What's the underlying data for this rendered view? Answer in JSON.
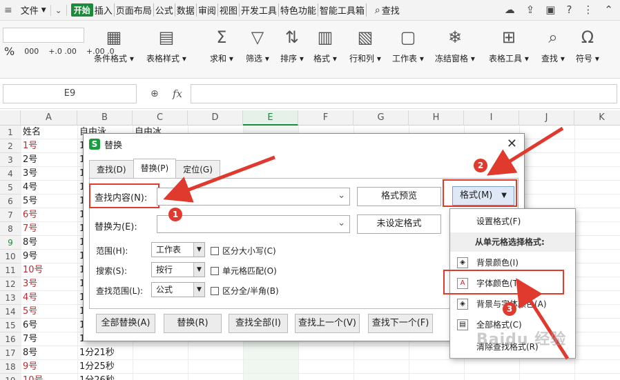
{
  "menubar": {
    "file": "文件",
    "tabs": [
      "开始",
      "插入",
      "页面布局",
      "公式",
      "数据",
      "审阅",
      "视图",
      "开发工具",
      "特色功能",
      "智能工具箱"
    ],
    "search": "查找"
  },
  "ribbon": {
    "number_formats": [
      "%",
      "000",
      "+.0 .00",
      "+.00 .0"
    ],
    "groups": [
      {
        "label": "条件格式",
        "icon": "conditional-format-icon"
      },
      {
        "label": "表格样式",
        "icon": "table-style-icon"
      },
      {
        "label": "求和",
        "icon": "sum-icon"
      },
      {
        "label": "筛选",
        "icon": "filter-icon"
      },
      {
        "label": "排序",
        "icon": "sort-icon"
      },
      {
        "label": "格式",
        "icon": "format-icon"
      },
      {
        "label": "行和列",
        "icon": "rows-cols-icon"
      },
      {
        "label": "工作表",
        "icon": "worksheet-icon"
      },
      {
        "label": "冻结窗格",
        "icon": "freeze-icon"
      },
      {
        "label": "表格工具",
        "icon": "table-tools-icon"
      },
      {
        "label": "查找",
        "icon": "find-icon"
      },
      {
        "label": "符号",
        "icon": "symbol-icon"
      }
    ]
  },
  "formula_bar": {
    "name_box": "E9",
    "fx": "fx"
  },
  "sheet": {
    "columns": [
      "A",
      "B",
      "C",
      "D",
      "E",
      "F",
      "G",
      "H",
      "I",
      "J",
      "K"
    ],
    "rows": [
      "1",
      "2",
      "3",
      "4",
      "5",
      "6",
      "7",
      "8",
      "9",
      "10",
      "11",
      "12",
      "13",
      "14",
      "15",
      "16",
      "17",
      "18",
      "19"
    ],
    "col_a": [
      "姓名",
      "1号",
      "2号",
      "3号",
      "4号",
      "5号",
      "6号",
      "7号",
      "8号",
      "9号",
      "10号",
      "3号",
      "4号",
      "5号",
      "6号",
      "7号",
      "8号",
      "9号",
      "10号"
    ],
    "col_a_red": [
      false,
      true,
      false,
      false,
      false,
      false,
      true,
      true,
      false,
      false,
      true,
      true,
      true,
      true,
      false,
      false,
      false,
      true,
      true
    ],
    "b1": "自由泳",
    "c1": "自由冰",
    "col_b_visible": [
      "1",
      "1",
      "1",
      "1",
      "1",
      "1",
      "1",
      "1",
      "1",
      "1",
      "1",
      "1",
      "1",
      "1",
      "1",
      "1分21秒",
      "1分25秒",
      "1分26秒"
    ]
  },
  "dialog": {
    "title": "替换",
    "tabs": [
      "查找(D)",
      "替换(P)",
      "定位(G)"
    ],
    "find_label": "查找内容(N):",
    "replace_label": "替换为(E):",
    "format_preview": "格式预览",
    "no_format": "未设定格式",
    "format_button": "格式(M)",
    "scope_label": "范围(H):",
    "scope_value": "工作表",
    "search_label": "搜索(S):",
    "search_value": "按行",
    "lookin_label": "查找范围(L):",
    "lookin_value": "公式",
    "match_case": "区分大小写(C)",
    "match_cell": "单元格匹配(O)",
    "match_width": "区分全/半角(B)",
    "buttons": [
      "全部替换(A)",
      "替换(R)",
      "查找全部(I)",
      "查找上一个(V)",
      "查找下一个(F)"
    ]
  },
  "dropdown": {
    "items": [
      {
        "label": "设置格式(F)"
      },
      {
        "label": "从单元格选择格式:"
      },
      {
        "label": "背景颜色(I)"
      },
      {
        "label": "字体颜色(T)"
      },
      {
        "label": "背景与字体颜色(A)"
      },
      {
        "label": "全部格式(C)"
      },
      {
        "label": "清除查找格式(R)"
      }
    ]
  },
  "annotations": {
    "badges": [
      "1",
      "2",
      "3"
    ],
    "watermark": "Baidu 经验"
  },
  "colors": {
    "accent_green": "#1a8b3a",
    "annotation_red": "#e03a2f",
    "text_red": "#c0282d"
  }
}
